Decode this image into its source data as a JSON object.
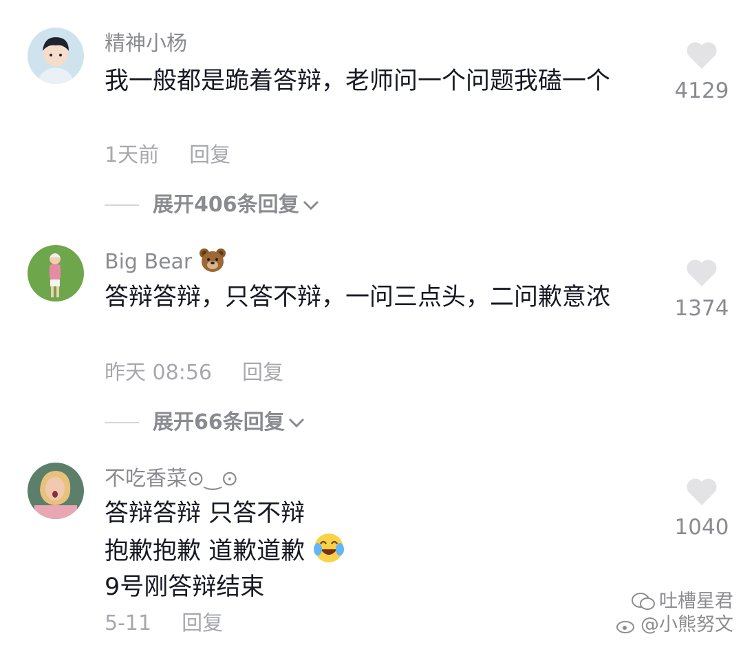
{
  "comments": [
    {
      "username": "精神小杨",
      "text": "我一般都是跪着答辩，老师问一个问题我磕一个",
      "time": "1天前",
      "reply_label": "回复",
      "expand_label": "展开406条回复",
      "likes": "4129",
      "avatar": "boy-avatar"
    },
    {
      "username": "Big Bear",
      "username_emoji": "bear-face-icon",
      "text": "答辩答辩，只答不辩，一问三点头，二问歉意浓",
      "time": "昨天 08:56",
      "reply_label": "回复",
      "expand_label": "展开66条回复",
      "likes": "1374",
      "avatar": "old-man-avatar"
    },
    {
      "username": "不吃香菜⊙‿⊙",
      "text_lines": [
        "答辩答辩 只答不辩",
        "抱歉抱歉 道歉道歉",
        "9号刚答辩结束"
      ],
      "text_emoji": "crying-laughing-face-icon",
      "time": "5-11",
      "reply_label": "回复",
      "likes": "1040",
      "avatar": "girl-avatar"
    }
  ],
  "watermark": {
    "line1": "吐槽星君",
    "line2": "@小熊努文"
  },
  "colors": {
    "text": "#161823",
    "secondary": "#8a8b91",
    "heart": "#e3e3e5"
  }
}
